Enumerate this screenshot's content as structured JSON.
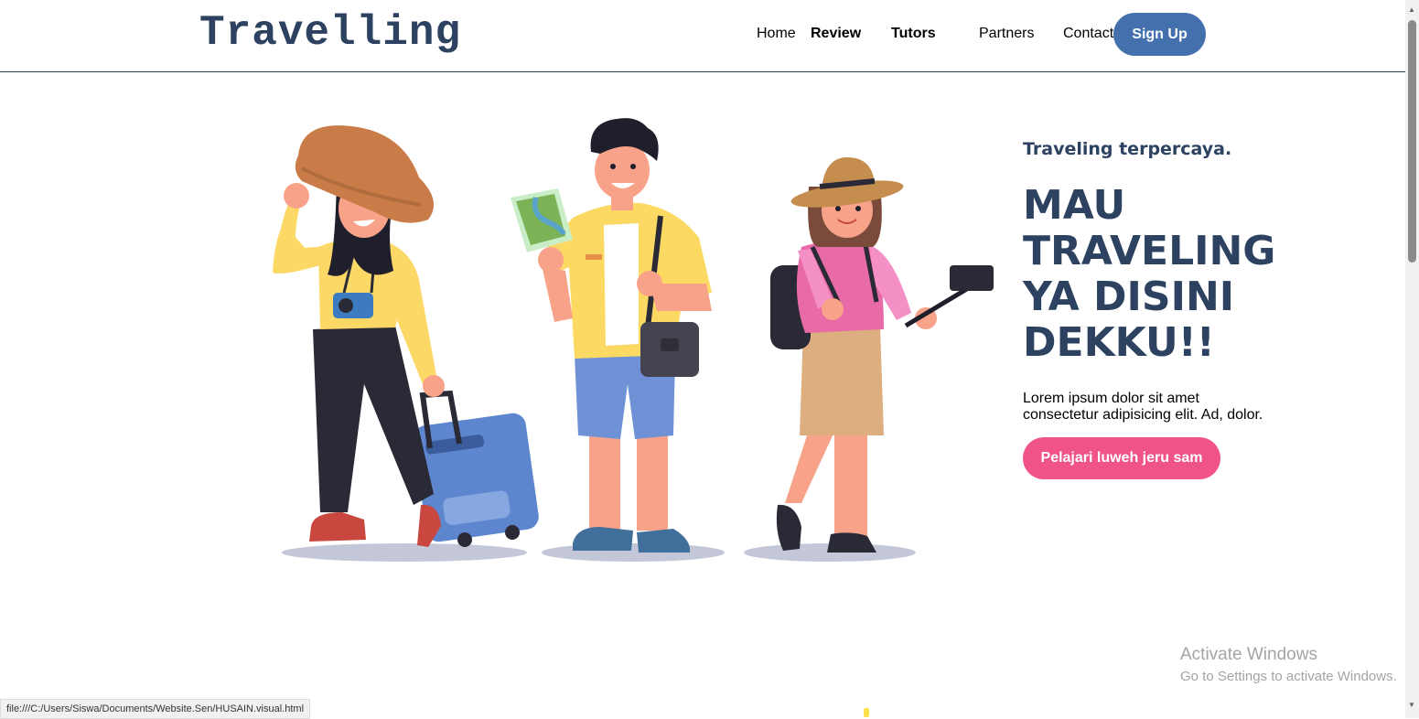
{
  "header": {
    "logo": "Travelling",
    "nav": [
      "Home",
      "Review",
      "Tutors",
      "Partners",
      "Contact"
    ],
    "signup_label": "Sign Up"
  },
  "hero": {
    "tagline": "Traveling terpercaya.",
    "headline": "MAU TRAVELING YA DISINI DEKKU!!",
    "description": "Lorem ipsum dolor sit amet consectetur adipisicing elit. Ad, dolor.",
    "cta_label": "Pelajari luweh jeru sam"
  },
  "windows": {
    "activate_title": "Activate Windows",
    "activate_sub": "Go to Settings to activate Windows."
  },
  "statusbar": {
    "url": "file:///C:/Users/Siswa/Documents/Website.Sen/HUSAIN.visual.html"
  },
  "colors": {
    "brand": "#2c4260",
    "signup": "#4470ae",
    "cta": "#f0528a"
  }
}
